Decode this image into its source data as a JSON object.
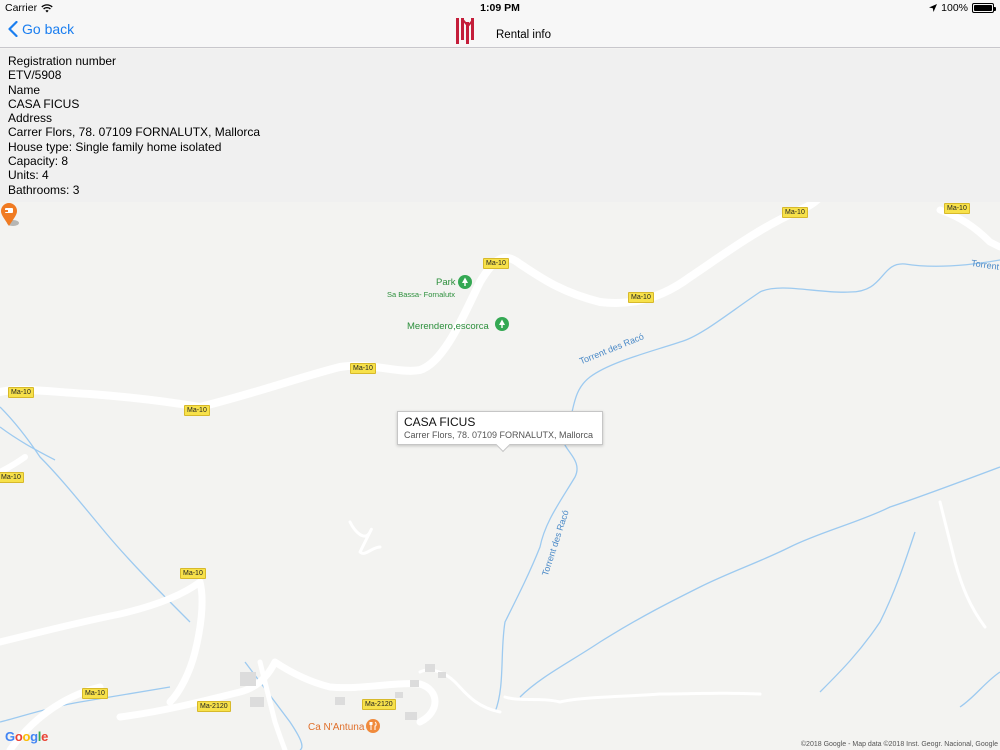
{
  "status_bar": {
    "carrier": "Carrier",
    "time": "1:09 PM",
    "battery": "100%",
    "icons": [
      "wifi-icon",
      "location-arrow-icon",
      "battery-icon"
    ]
  },
  "nav": {
    "back_label": "Go back",
    "title": "Rental info",
    "logo": "balearic-logo"
  },
  "info": {
    "registration_label": "Registration number",
    "registration_value": "ETV/5908",
    "name_label": "Name",
    "name_value": "CASA FICUS",
    "address_label": "Address",
    "address_value": "Carrer Flors, 78. 07109 FORNALUTX, Mallorca",
    "house_type": "House type: Single family home isolated",
    "capacity": "Capacity: 8",
    "units": "Units: 4",
    "bathrooms": "Bathrooms: 3"
  },
  "map": {
    "callout_title": "CASA FICUS",
    "callout_address": "Carrer Flors, 78. 07109 FORNALUTX, Mallorca",
    "road_labels": [
      "Ma-10",
      "Ma-10",
      "Ma-10",
      "Ma-10",
      "Ma-10",
      "Ma-10",
      "Ma-10",
      "Ma-10",
      "Ma-10",
      "Ma-10",
      "Ma-2120",
      "Ma-2120"
    ],
    "poi_park": "Park",
    "poi_park_sub": "Sa Bassa- Fornalutx",
    "poi_merendero": "Merendero,escorca",
    "water_1": "Torrent des Racó",
    "water_2": "Torrent des Racó",
    "water_3": "Torrent",
    "restaurant": "Ca N'Antuna",
    "google": "Google",
    "copyright": "©2018 Google - Map data ©2018 Inst. Geogr. Nacional, Google",
    "colors": {
      "pin": "#f07b22",
      "water": "#8fc3ee",
      "park_green": "#2c8f3c",
      "road_label_bg": "#f7e14a"
    }
  }
}
